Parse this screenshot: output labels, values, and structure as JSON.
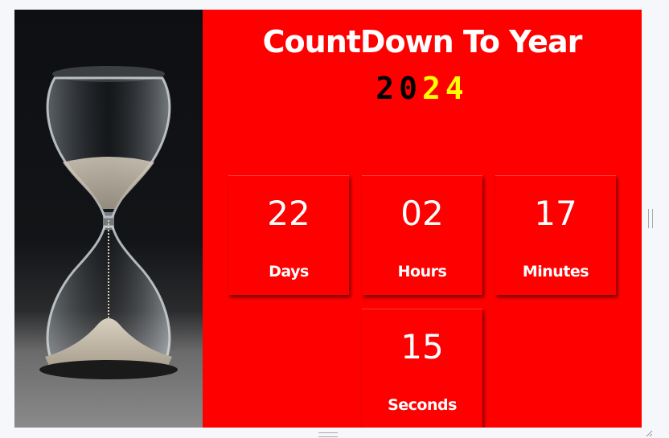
{
  "title": "CountDown To Year",
  "year_digits": [
    "2",
    "0",
    "2",
    "4"
  ],
  "colors": {
    "background": "#ff0000",
    "text": "#ffffff",
    "year_old": "#000000",
    "year_new": "#ffff00"
  },
  "image": {
    "icon": "hourglass-icon"
  },
  "countdown": [
    {
      "value": "22",
      "label": "Days"
    },
    {
      "value": "02",
      "label": "Hours"
    },
    {
      "value": "17",
      "label": "Minutes"
    },
    {
      "value": "15",
      "label": "Seconds"
    }
  ]
}
